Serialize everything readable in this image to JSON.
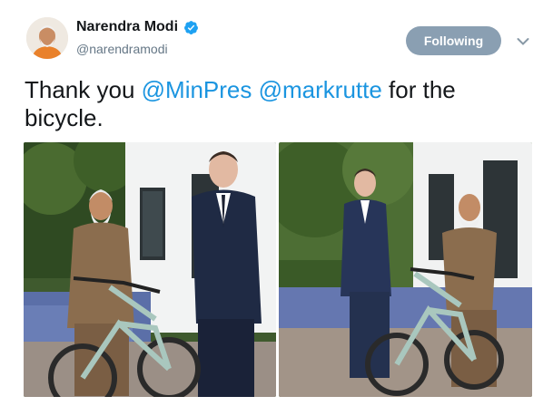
{
  "user": {
    "display_name": "Narendra Modi",
    "handle": "@narendramodi",
    "verified": true
  },
  "follow_button": {
    "label": "Following"
  },
  "menu": {
    "icon": "chevron-down-icon"
  },
  "tweet": {
    "text_prefix": "Thank you ",
    "mention_1": "@MinPres",
    "space": " ",
    "mention_2": "@markrutte",
    "text_suffix": " for the bicycle."
  },
  "colors": {
    "accent": "#1b95e0",
    "follow_bg": "#8a9fb2",
    "verified": "#1da1f2"
  }
}
